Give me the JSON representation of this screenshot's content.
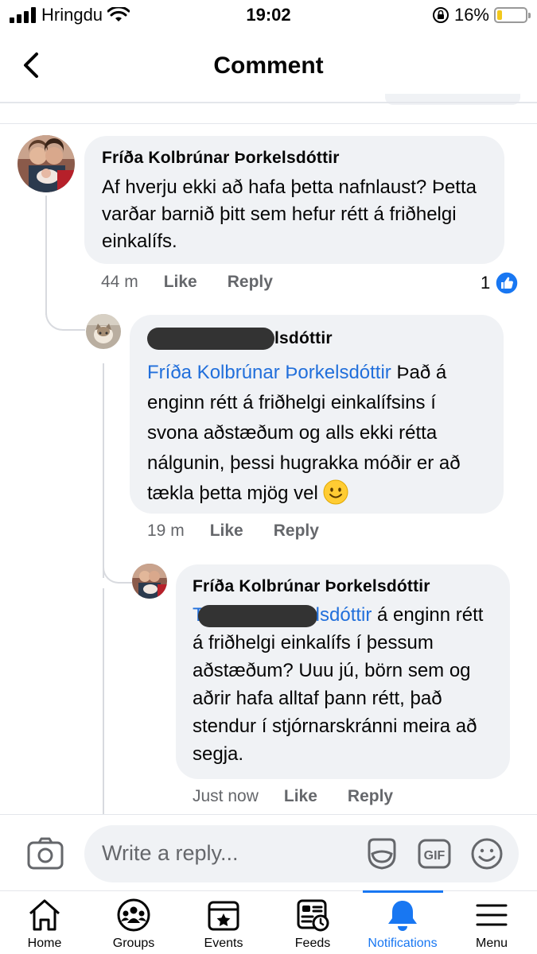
{
  "status_bar": {
    "carrier": "Hringdu",
    "time": "19:02",
    "battery": "16%"
  },
  "header": {
    "title": "Comment"
  },
  "comments": [
    {
      "author": "Fríða Kolbrúnar Þorkelsdóttir",
      "text": "Af hverju ekki að hafa þetta nafnlaust? Þetta varðar barnið þitt sem hefur rétt á friðhelgi einkalífs.",
      "time": "44 m",
      "like_label": "Like",
      "reply_label": "Reply",
      "reaction_count": "1"
    },
    {
      "author_suffix": "lsdóttir",
      "mention": "Fríða Kolbrúnar Þorkelsdóttir",
      "text": "Það á enginn rétt á friðhelgi einkalífsins í svona aðstæðum og alls ekki rétta nálgunin, þessi hugrakka móðir er að tækla þetta mjög vel",
      "time": "19 m",
      "like_label": "Like",
      "reply_label": "Reply"
    },
    {
      "author": "Fríða Kolbrúnar Þorkelsdóttir",
      "mention_prefix": "T",
      "mention_suffix": "lsdóttir",
      "text_line1": " á enginn",
      "text_rest": "rétt á friðhelgi einkalífs í þessum aðstæðum? Uuu jú, börn sem og aðrir hafa alltaf þann rétt, það stendur í stjórnarskránni meira að segja.",
      "time": "Just now",
      "like_label": "Like",
      "reply_label": "Reply"
    }
  ],
  "reply_bar": {
    "placeholder": "Write a reply...",
    "gif_label": "GIF"
  },
  "nav": {
    "items": [
      {
        "label": "Home",
        "icon": "home-icon"
      },
      {
        "label": "Groups",
        "icon": "groups-icon"
      },
      {
        "label": "Events",
        "icon": "events-icon"
      },
      {
        "label": "Feeds",
        "icon": "feeds-icon"
      },
      {
        "label": "Notifications",
        "icon": "bell-icon",
        "active": true
      },
      {
        "label": "Menu",
        "icon": "menu-icon"
      }
    ]
  },
  "colors": {
    "accent": "#1877f2",
    "mention": "#216fdb",
    "bubble": "#f0f2f5",
    "battery_fill": "#f2c81c"
  }
}
